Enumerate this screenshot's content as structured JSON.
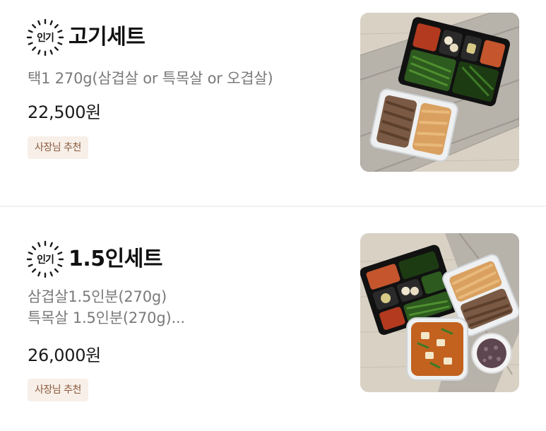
{
  "menu": {
    "items": [
      {
        "badge": "인기",
        "name": "고기세트",
        "desc_lines": [
          "택1 270g(삼겹살 or 특목살 or 오겹살)"
        ],
        "price": "22,500원",
        "tag": "사장님 추천",
        "image": "meat-set-photo"
      },
      {
        "badge": "인기",
        "name": "1.5인세트",
        "desc_lines": [
          "삼겹살1.5인분(270g)",
          "특목살 1.5인분(270g)..."
        ],
        "price": "26,000원",
        "tag": "사장님 추천",
        "image": "one-and-half-set-photo"
      }
    ]
  },
  "colors": {
    "tag_bg": "#f7efe8",
    "tag_text": "#8a5a3c",
    "desc_text": "#7a7a7a",
    "divider": "#f1f1f1"
  }
}
